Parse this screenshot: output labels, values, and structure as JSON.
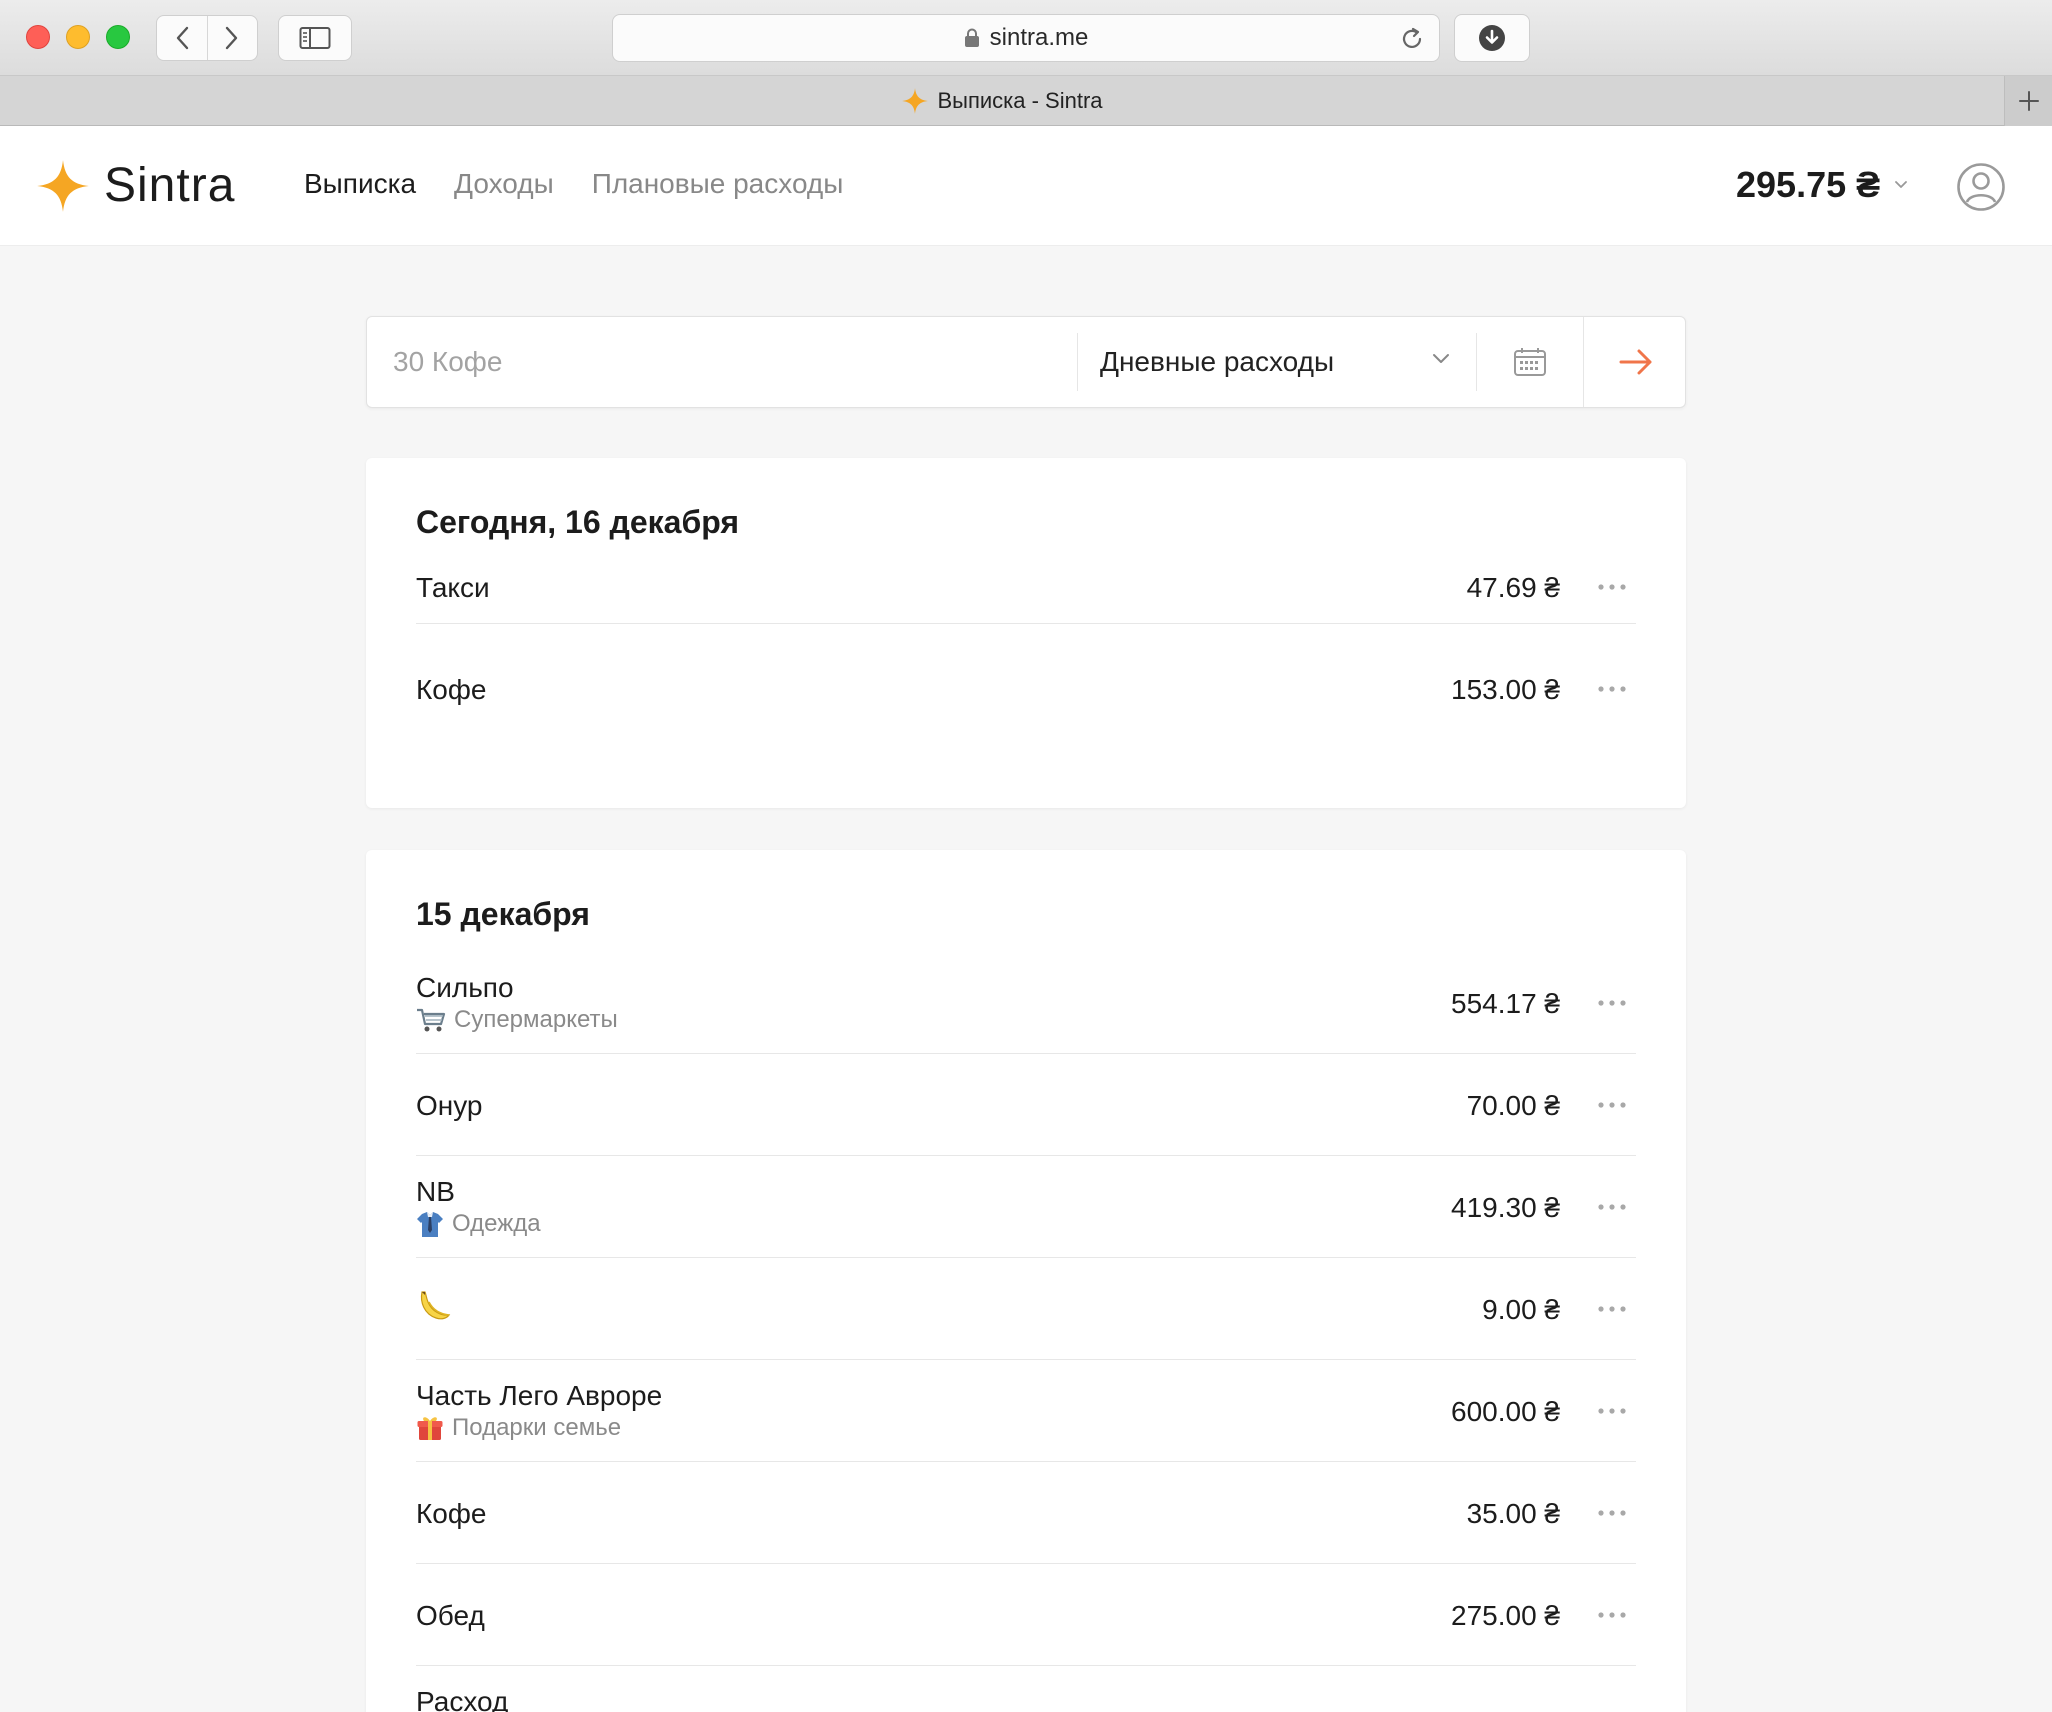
{
  "browser": {
    "url": "sintra.me",
    "tab_title": "Выписка - Sintra"
  },
  "app": {
    "brand": "Sintra",
    "nav": [
      {
        "label": "Выписка",
        "active": true
      },
      {
        "label": "Доходы",
        "active": false
      },
      {
        "label": "Плановые расходы",
        "active": false
      }
    ],
    "balance": "295.75 ₴",
    "accent_color": "#f5a623",
    "submit_arrow_color": "#f0754a"
  },
  "entry": {
    "placeholder": "30 Кофе",
    "category": "Дневные расходы"
  },
  "days": [
    {
      "title": "Сегодня, 16 декабря",
      "transactions": [
        {
          "name": "Такси",
          "amount": "47.69 ₴"
        },
        {
          "name": "Кофе",
          "amount": "153.00 ₴"
        }
      ]
    },
    {
      "title": "15 декабря",
      "transactions": [
        {
          "name": "Сильпо",
          "category": "Супермаркеты",
          "category_icon": "shopping-cart-icon",
          "amount": "554.17 ₴"
        },
        {
          "name": "Онур",
          "amount": "70.00 ₴"
        },
        {
          "name": "NB",
          "category": "Одежда",
          "category_icon": "shirt-tie-icon",
          "amount": "419.30 ₴"
        },
        {
          "name": "",
          "name_icon": "banana-icon",
          "amount": "9.00 ₴"
        },
        {
          "name": "Часть Лего Авроре",
          "category": "Подарки семье",
          "category_icon": "gift-icon",
          "amount": "600.00 ₴"
        },
        {
          "name": "Кофе",
          "amount": "35.00 ₴"
        },
        {
          "name": "Обед",
          "amount": "275.00 ₴"
        },
        {
          "name": "Расход",
          "amount": ""
        }
      ]
    }
  ]
}
